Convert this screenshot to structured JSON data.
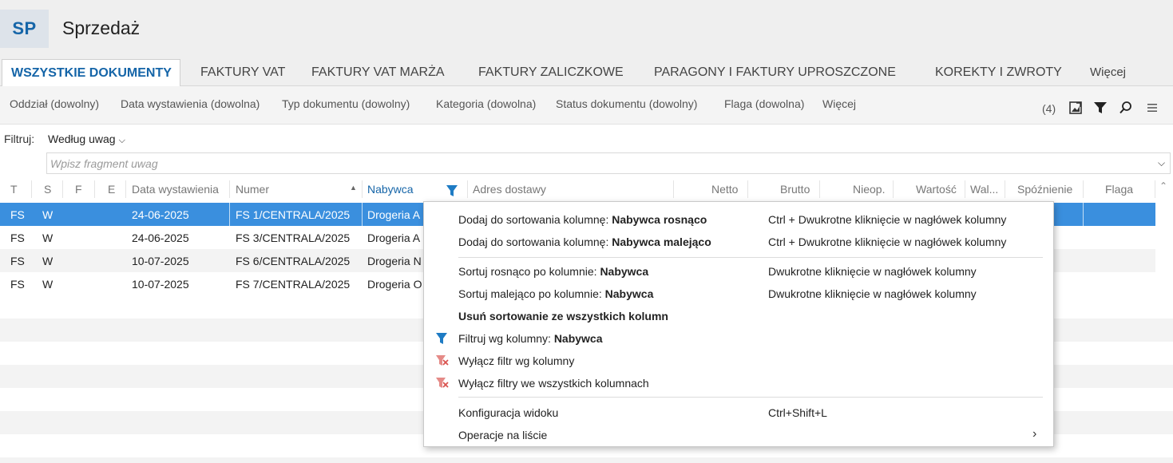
{
  "header": {
    "badge": "SP",
    "title": "Sprzedaż"
  },
  "tabs": [
    {
      "label": "WSZYSTKIE DOKUMENTY",
      "active": true
    },
    {
      "label": "FAKTURY VAT"
    },
    {
      "label": "FAKTURY VAT MARŻA"
    },
    {
      "label": "FAKTURY ZALICZKOWE"
    },
    {
      "label": "PARAGONY I FAKTURY UPROSZCZONE"
    },
    {
      "label": "KOREKTY I ZWROTY"
    },
    {
      "label": "Więcej"
    }
  ],
  "filterbar": {
    "items": [
      "Oddział (dowolny)",
      "Data wystawienia (dowolna)",
      "Typ dokumentu (dowolny)",
      "Kategoria (dowolna)",
      "Status dokumentu (dowolny)",
      "Flaga (dowolna)",
      "Więcej"
    ],
    "count": "(4)",
    "icons": [
      "export-icon",
      "filter-icon",
      "search-icon",
      "menu-icon"
    ]
  },
  "filter": {
    "label": "Filtruj:",
    "select_value": "Według uwag",
    "input_placeholder": "Wpisz fragment uwag",
    "input_value": ""
  },
  "grid": {
    "columns": [
      "T",
      "S",
      "F",
      "E",
      "Data wystawienia",
      "Numer",
      "Nabywca",
      "Adres dostawy",
      "Netto",
      "Brutto",
      "Nieop.",
      "Wartość",
      "Wal...",
      "Spóźnienie",
      "Flaga"
    ],
    "rows": [
      {
        "T": "FS",
        "S": "W",
        "date": "24-06-2025",
        "number": "FS 1/CENTRALA/2025",
        "buyer": "Drogeria A",
        "selected": true
      },
      {
        "T": "FS",
        "S": "W",
        "date": "24-06-2025",
        "number": "FS 3/CENTRALA/2025",
        "buyer": "Drogeria A"
      },
      {
        "T": "FS",
        "S": "W",
        "date": "10-07-2025",
        "number": "FS 6/CENTRALA/2025",
        "buyer": "Drogeria N"
      },
      {
        "T": "FS",
        "S": "W",
        "date": "10-07-2025",
        "number": "FS 7/CENTRALA/2025",
        "buyer": "Drogeria O"
      }
    ]
  },
  "context_menu": {
    "items": [
      {
        "label": "Dodaj do sortowania kolumnę: ",
        "bold": "Nabywca rosnąco",
        "shortcut": "Ctrl + Dwukrotne kliknięcie w nagłówek kolumny"
      },
      {
        "label": "Dodaj do sortowania kolumnę: ",
        "bold": "Nabywca malejąco",
        "shortcut": "Ctrl + Dwukrotne kliknięcie w nagłówek kolumny"
      },
      {
        "label": "Sortuj rosnąco po kolumnie: ",
        "bold": "Nabywca",
        "shortcut": "Dwukrotne kliknięcie w nagłówek kolumny"
      },
      {
        "label": "Sortuj malejąco po kolumnie: ",
        "bold": "Nabywca",
        "shortcut": "Dwukrotne kliknięcie w nagłówek kolumny"
      },
      {
        "label": "Usuń sortowanie ze wszystkich kolumn",
        "bold": "",
        "shortcut": ""
      },
      {
        "label": "Filtruj wg kolumny: ",
        "bold": "Nabywca",
        "shortcut": "",
        "icon": "filter-icon"
      },
      {
        "label": "Wyłącz filtr wg kolumny",
        "bold": "",
        "shortcut": "",
        "icon": "filter-remove-icon"
      },
      {
        "label": "Wyłącz filtry we wszystkich kolumnach",
        "bold": "",
        "shortcut": "",
        "icon": "filter-remove-all-icon"
      },
      {
        "label": "Konfiguracja widoku",
        "bold": "",
        "shortcut": "Ctrl+Shift+L"
      },
      {
        "label": "Operacje na liście",
        "bold": "",
        "shortcut": "",
        "submenu": "›"
      }
    ]
  },
  "colors": {
    "accent": "#1565a8",
    "selected_row": "#3a8fde",
    "filter_icon": "#1e7bc4",
    "remove_icon": "#d9534f"
  }
}
